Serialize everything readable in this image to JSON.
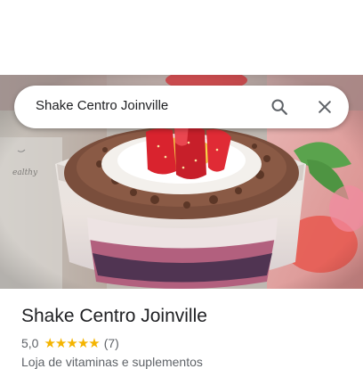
{
  "search": {
    "value": "Shake Centro Joinville",
    "search_icon": "search-icon",
    "close_icon": "close-icon"
  },
  "place": {
    "title": "Shake Centro Joinville",
    "rating": "5,0",
    "stars": 5,
    "review_count": "(7)",
    "category": "Loja de vitaminas e suplementos"
  },
  "photo": {
    "subject": "dessert cup with strawberries",
    "cup_text": "ealthy"
  },
  "colors": {
    "star": "#f4b400",
    "text_primary": "#202124",
    "text_secondary": "#5f6368"
  }
}
